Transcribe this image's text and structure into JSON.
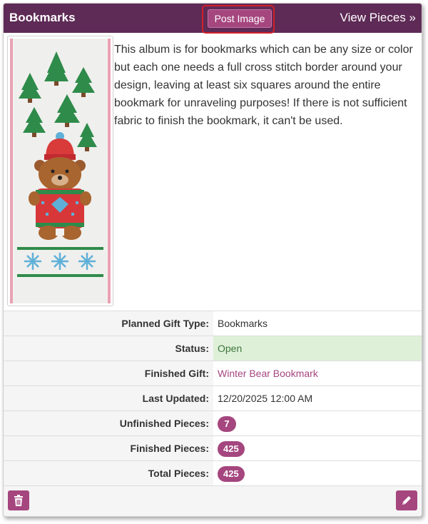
{
  "header": {
    "title": "Bookmarks",
    "post_button": "Post Image",
    "view_link": "View Pieces »"
  },
  "description": "This album is for bookmarks which can be any size or color but each one needs a full cross stitch border around your design, leaving at least six squares around the entire bookmark for unraveling purposes! If there is not sufficient fabric to finish the bookmark, it can't be used.",
  "details": {
    "planned_gift_type": {
      "label": "Planned Gift Type:",
      "value": "Bookmarks"
    },
    "status": {
      "label": "Status:",
      "value": "Open"
    },
    "finished_gift": {
      "label": "Finished Gift:",
      "value": "Winter Bear Bookmark"
    },
    "last_updated": {
      "label": "Last Updated:",
      "value": "12/20/2025 12:00 AM"
    },
    "unfinished_pieces": {
      "label": "Unfinished Pieces:",
      "value": "7"
    },
    "finished_pieces": {
      "label": "Finished Pieces:",
      "value": "425"
    },
    "total_pieces": {
      "label": "Total Pieces:",
      "value": "425"
    }
  },
  "footer": {
    "delete_icon": "trash-icon",
    "edit_icon": "pencil-icon"
  },
  "colors": {
    "header_bg": "#5e2a56",
    "accent": "#a5467f",
    "status_bg": "#dff0d8",
    "status_text": "#3c763d",
    "highlight_outline": "#d0202a"
  }
}
